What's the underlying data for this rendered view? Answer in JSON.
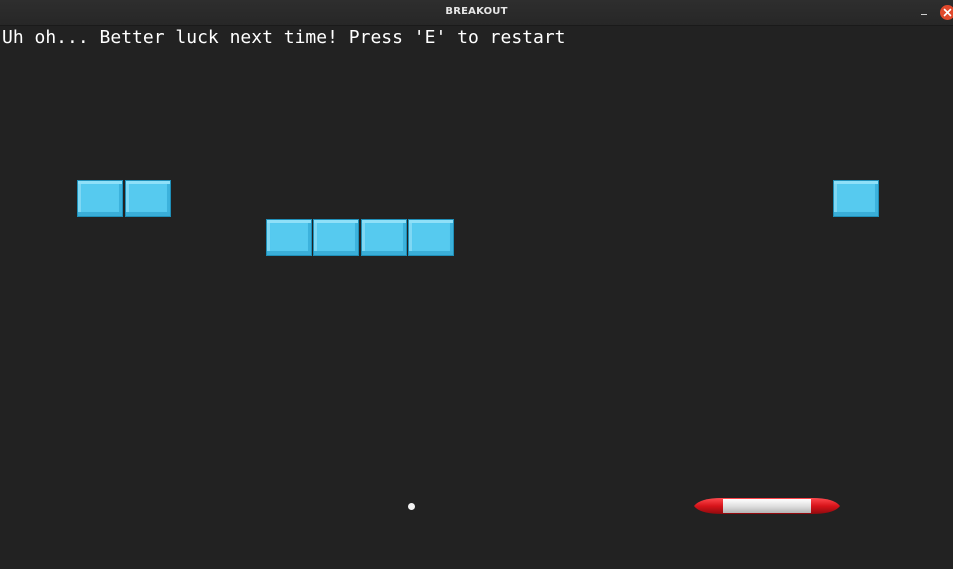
{
  "window": {
    "title": "BREAKOUT",
    "minimize_label": "–",
    "close_label": "×"
  },
  "game": {
    "message": "Uh oh... Better luck next time! Press 'E' to restart",
    "brick_color": "#55c9ef",
    "paddle_colors": [
      "#d8141a",
      "#e6e6e6"
    ],
    "ball_color": "#f2f2f2",
    "background": "#222222"
  }
}
